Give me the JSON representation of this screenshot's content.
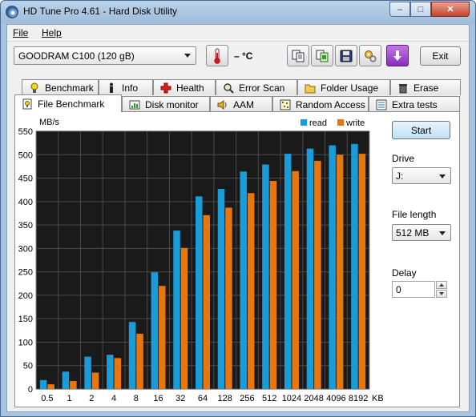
{
  "window": {
    "title": "HD Tune Pro 4.61 - Hard Disk Utility",
    "controls": {
      "minimize": "–",
      "maximize": "□",
      "close": "✕"
    }
  },
  "menu": {
    "file": "File",
    "help": "Help"
  },
  "toolbar": {
    "drive": "GOODRAM C100 (120 gB)",
    "temperature": "– °C",
    "exit": "Exit",
    "icons": [
      "thermometer-icon",
      "copy-icon",
      "copy-screenshot-icon",
      "save-icon",
      "options-icon",
      "download-icon"
    ]
  },
  "tabs_row1": [
    {
      "label": "Benchmark",
      "icon": "lightbulb-icon"
    },
    {
      "label": "Info",
      "icon": "info-icon"
    },
    {
      "label": "Health",
      "icon": "health-cross-icon"
    },
    {
      "label": "Error Scan",
      "icon": "magnifier-icon"
    },
    {
      "label": "Folder Usage",
      "icon": "folder-icon"
    },
    {
      "label": "Erase",
      "icon": "trash-icon"
    }
  ],
  "tabs_row2": [
    {
      "label": "File Benchmark",
      "icon": "file-benchmark-icon",
      "active": true
    },
    {
      "label": "Disk monitor",
      "icon": "monitor-chart-icon"
    },
    {
      "label": "AAM",
      "icon": "speaker-icon"
    },
    {
      "label": "Random Access",
      "icon": "random-dots-icon"
    },
    {
      "label": "Extra tests",
      "icon": "extra-tests-icon"
    }
  ],
  "sidebar": {
    "start": "Start",
    "drive_label": "Drive",
    "drive_value": "J:",
    "file_length_label": "File length",
    "file_length_value": "512 MB",
    "delay_label": "Delay",
    "delay_value": "0"
  },
  "colors": {
    "read": "#1a9cd8",
    "write": "#e8760f",
    "plot_bg": "#1a1a1a",
    "grid": "#4a4a4a"
  },
  "chart_data": {
    "type": "bar",
    "ylabel": "MB/s",
    "xunit": "KB",
    "ylim": [
      0,
      550
    ],
    "yticks": [
      0,
      50,
      100,
      150,
      200,
      250,
      300,
      350,
      400,
      450,
      500,
      550
    ],
    "categories": [
      "0.5",
      "1",
      "2",
      "4",
      "8",
      "16",
      "32",
      "64",
      "128",
      "256",
      "512",
      "1024",
      "2048",
      "4096",
      "8192"
    ],
    "legend": "top-right",
    "grid": true,
    "series": [
      {
        "name": "read",
        "values": [
          19,
          37,
          69,
          73,
          143,
          249,
          338,
          411,
          427,
          464,
          479,
          502,
          513,
          520,
          523
        ]
      },
      {
        "name": "write",
        "values": [
          10,
          17,
          35,
          66,
          118,
          220,
          301,
          371,
          387,
          418,
          444,
          465,
          487,
          500,
          502
        ]
      }
    ]
  }
}
